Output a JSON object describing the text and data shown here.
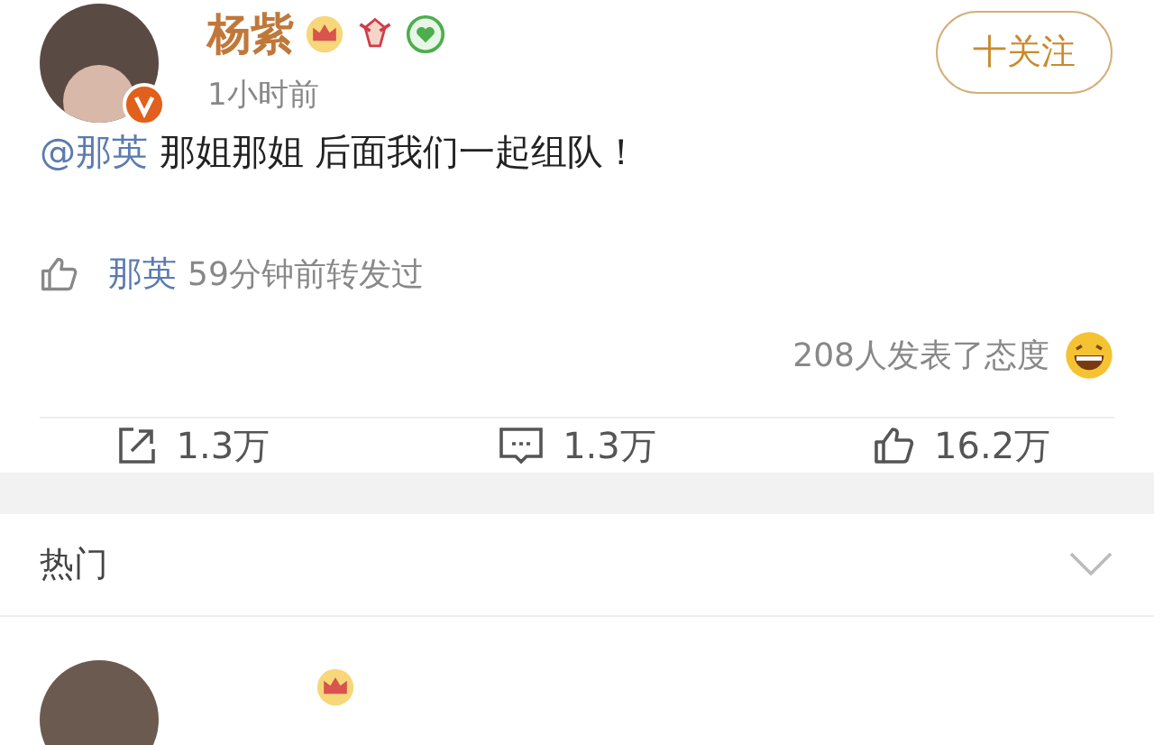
{
  "post": {
    "author": "杨紫",
    "time": "1小时前",
    "follow_button": "十关注",
    "mention": "@那英",
    "text": "那姐那姐 后面我们一起组队！"
  },
  "repost_note": {
    "user": "那英",
    "text": "59分钟前转发过"
  },
  "reactions": {
    "text": "208人发表了态度"
  },
  "actions": [
    {
      "kind": "share",
      "count": "1.3万"
    },
    {
      "kind": "comment",
      "count": "1.3万"
    },
    {
      "kind": "like",
      "count": "16.2万"
    }
  ],
  "section": {
    "title": "热门",
    "expanded": false
  }
}
